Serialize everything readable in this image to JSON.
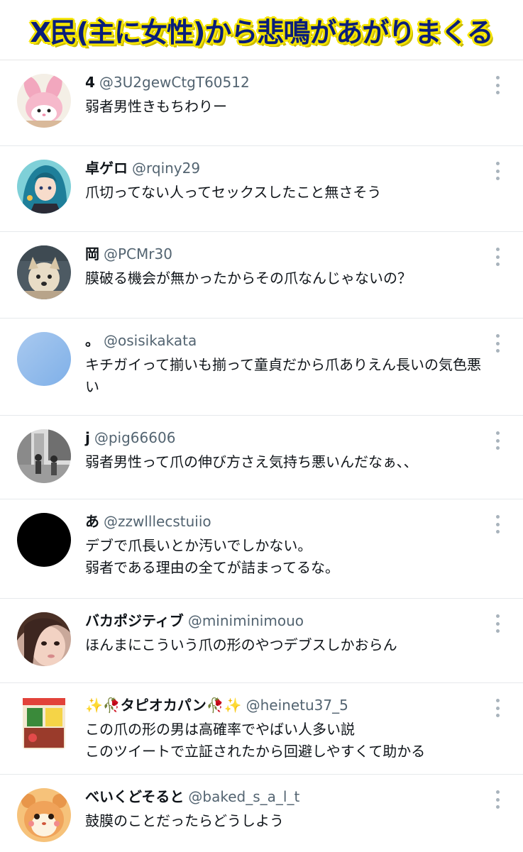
{
  "banner": {
    "title": "X民(主に女性)から悲鳴があがりまくる"
  },
  "replies": [
    {
      "name": "4",
      "handle": "@3U2gewCtgT60512",
      "text": "弱者男性きもちわりー",
      "avatar_icon": "pink-rabbit-avatar-icon"
    },
    {
      "name": "卓ゲロ",
      "handle": "@rqiny29",
      "text": "爪切ってない人ってセックスしたこと無さそう",
      "avatar_icon": "anime-girl-avatar-icon"
    },
    {
      "name": "岡",
      "handle": "@PCMr30",
      "text": "膜破る機会が無かったからその爪なんじゃないの？",
      "avatar_icon": "dog-avatar-icon"
    },
    {
      "name": "。",
      "handle": "@osisikakata",
      "text": "キチガイって揃いも揃って童貞だから爪ありえん長いの気色悪\nい",
      "avatar_icon": "blue-sky-avatar-icon"
    },
    {
      "name": "j",
      "handle": "@pig66606",
      "text": "弱者男性って爪の伸び方さえ気持ち悪いんだなぁ、、",
      "avatar_icon": "manga-street-avatar-icon"
    },
    {
      "name": "あ",
      "handle": "@zzwlllecstuiio",
      "text": "デブで爪長いとか汚いでしかない。\n弱者である理由の全てが詰まってるな。",
      "avatar_icon": "black-circle-avatar-icon"
    },
    {
      "name": "バカポジティブ",
      "handle": "@miniminimouo",
      "text": "ほんまにこういう爪の形のやつデブスしかおらん",
      "avatar_icon": "woman-face-avatar-icon"
    },
    {
      "name": "✨🥀タピオカパン🥀✨",
      "handle": "@heinetu37_5",
      "text": "この爪の形の男は高確率でやばい人多い説\nこのツイートで立証されたから回避しやすくて助かる",
      "avatar_icon": "snack-package-avatar-icon"
    },
    {
      "name": "べいくどそると",
      "handle": "@baked_s_a_l_t",
      "text": "鼓膜のことだったらどうしよう",
      "avatar_icon": "hamster-avatar-icon"
    }
  ],
  "colors": {
    "banner_text": "#0a1e7a",
    "banner_outline": "#f5e400",
    "handle": "#536471",
    "divider": "#e6e9ec"
  }
}
